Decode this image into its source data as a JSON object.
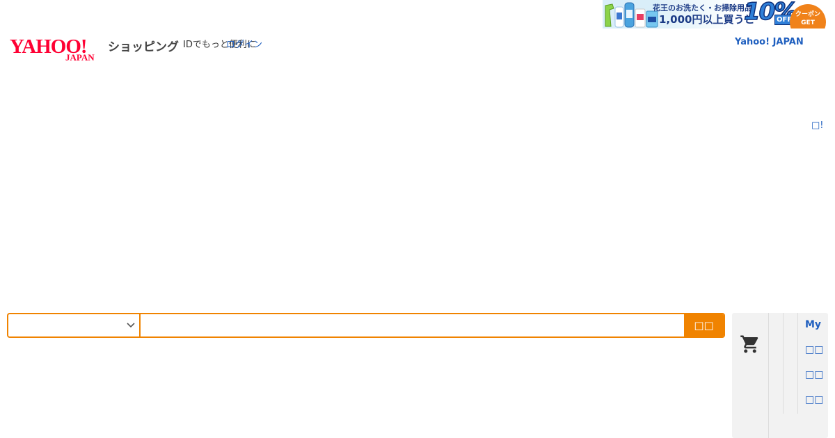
{
  "banner": {
    "line1": "花王のお洗たく・お掃除用品",
    "line2": "1,000円以上買うと",
    "percent": "10%",
    "off": "OFF",
    "coupon_top": "クーポン",
    "coupon_bottom": "GET",
    "colors": {
      "navy": "#1c3b86",
      "blue": "#2f7fd8",
      "orange": "#f0821a"
    }
  },
  "header": {
    "logo_text": "YAHOO!",
    "logo_subtext": "JAPAN",
    "service_name": "ショッピング",
    "id_text": "IDでもっと便利に",
    "login_label": "ログイン",
    "portal_link": "Yahoo! JAPAN",
    "small_link": "□!",
    "logo_color": "#ff0033",
    "link_color": "#1f5fbf"
  },
  "search": {
    "category_value": "",
    "query_value": "",
    "placeholder": "",
    "button_label": "□□",
    "accent_color": "#f08300",
    "chevron_icon": "chevron-down-icon"
  },
  "utility": {
    "cart_icon": "cart-icon",
    "links": [
      "My",
      "□□",
      "□□",
      "□□"
    ]
  }
}
